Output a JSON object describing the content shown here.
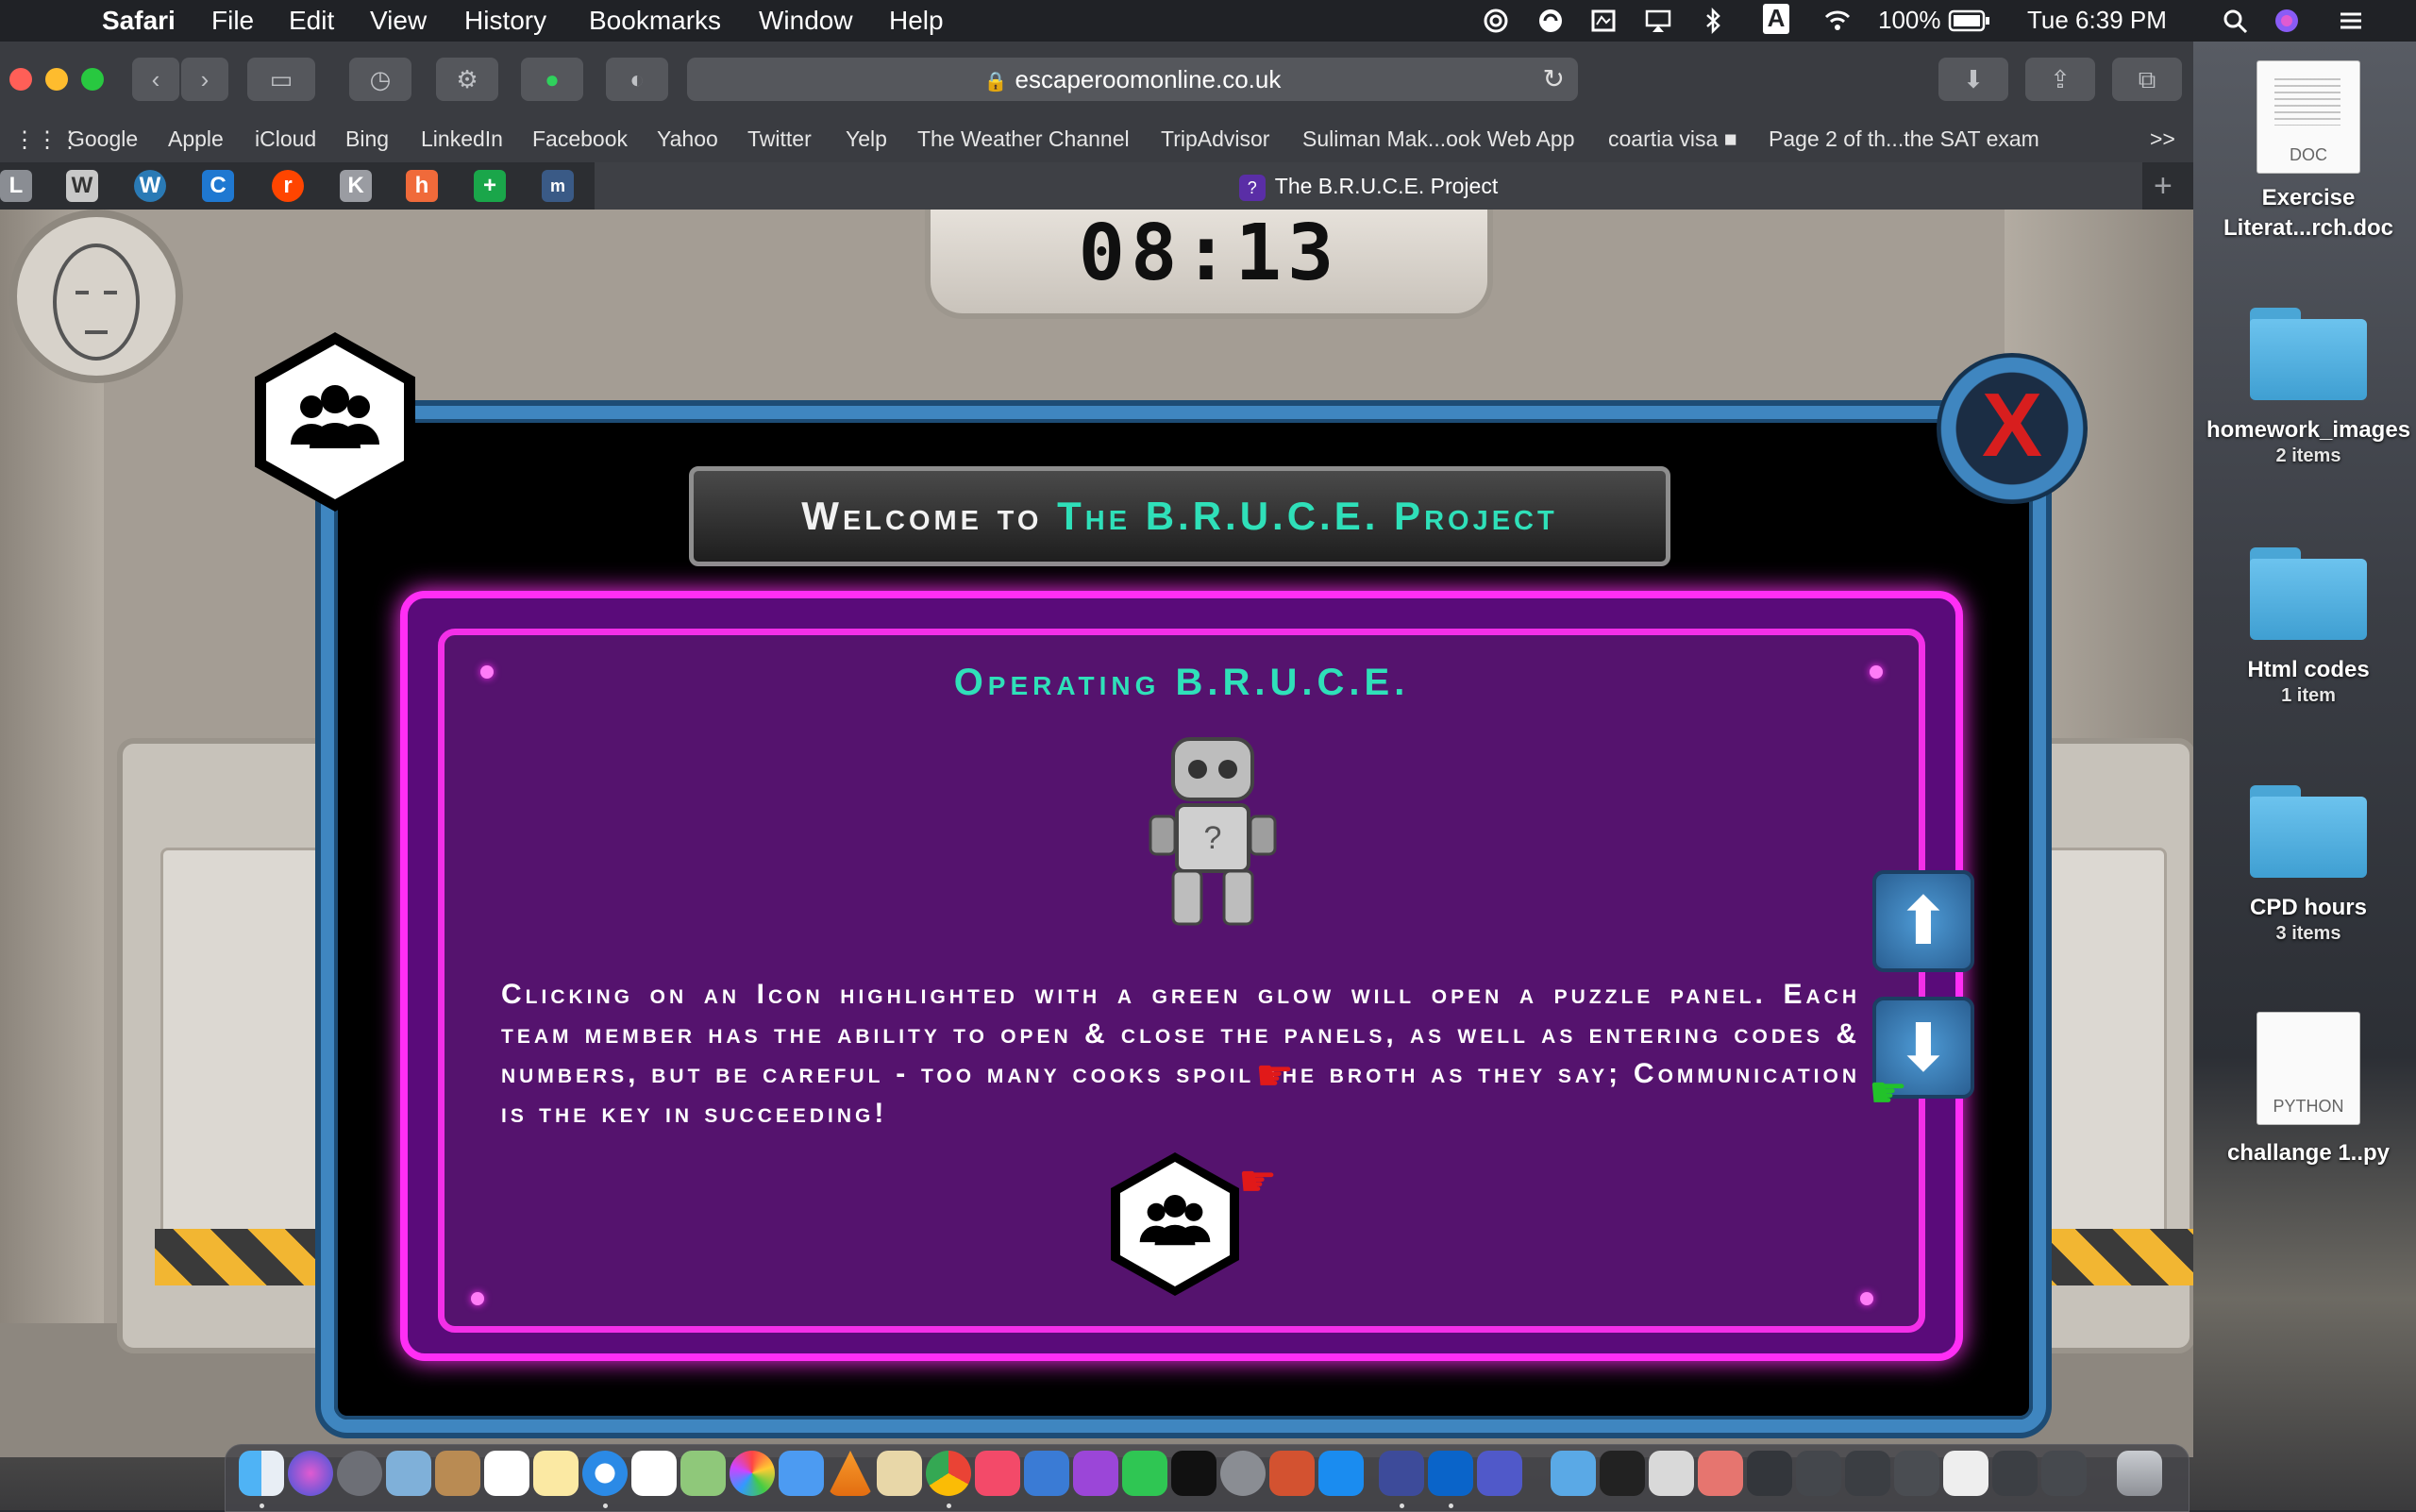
{
  "menubar": {
    "app_name": "Safari",
    "menus": [
      "File",
      "Edit",
      "View",
      "History",
      "Bookmarks",
      "Window",
      "Help"
    ],
    "battery": "100%",
    "input_source": "A",
    "clock": "Tue 6:39 PM"
  },
  "browser": {
    "url": "escaperoomonline.co.uk",
    "favorites": [
      "Google",
      "Apple",
      "iCloud",
      "Bing",
      "LinkedIn",
      "Facebook",
      "Yahoo",
      "Twitter",
      "Yelp",
      "The Weather Channel",
      "TripAdvisor",
      "Suliman Mak...ook Web App",
      "coartia visa ■",
      "Page 2 of th...the SAT exam"
    ],
    "more_favorites": ">>",
    "pinned_tabs": [
      "L",
      "W",
      "W",
      "C",
      "r",
      "K",
      "h",
      "+",
      "m"
    ],
    "active_tab": "The B.R.U.C.E. Project",
    "new_tab": "+"
  },
  "game": {
    "timer": "08:13",
    "welcome_prefix": "Welcome to",
    "welcome_title": "The B.R.U.C.E. Project",
    "panel_title": "Operating B.R.U.C.E.",
    "panel_text": "Clicking on an Icon highlighted with a green glow will open a puzzle panel. Each team member has the ability to open & close the panels, as well as entering codes & numbers, but be careful - too many cooks spoil the broth as they say; Communication is the key in succeeding!",
    "close_label": "X"
  },
  "desktop": {
    "items": [
      {
        "type": "doc",
        "ext": "DOC",
        "label": "Exercise Literat...rch.doc",
        "sub": ""
      },
      {
        "type": "folder",
        "label": "homework_images",
        "sub": "2 items"
      },
      {
        "type": "folder",
        "label": "Html codes",
        "sub": "1 item"
      },
      {
        "type": "folder",
        "label": "CPD hours",
        "sub": "3 items"
      },
      {
        "type": "doc",
        "ext": "PYTHON",
        "label": "challange 1..py",
        "sub": ""
      }
    ]
  },
  "colors": {
    "accent_teal": "#2fe0b9",
    "panel_magenta": "#ff2ef5",
    "panel_purple": "#55136e",
    "frame_blue": "#3f86c0",
    "close_red": "#d81e1e"
  }
}
